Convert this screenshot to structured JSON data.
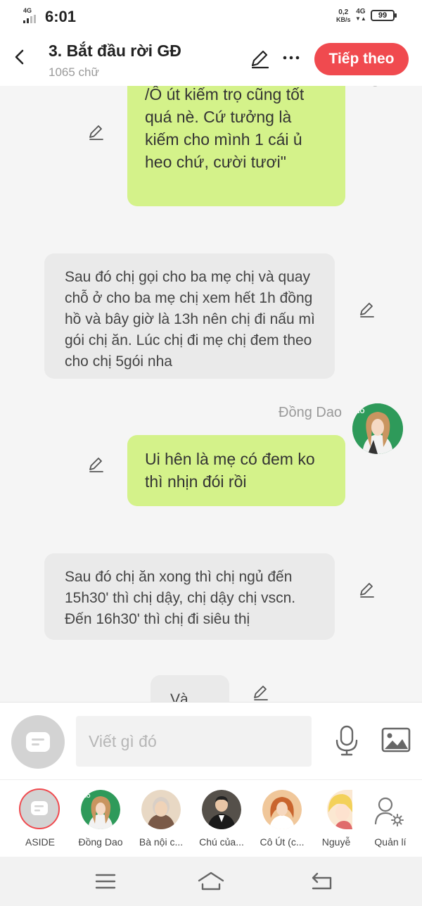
{
  "status_bar": {
    "network_top": "4G",
    "time": "6:01",
    "speed_value": "0,2",
    "speed_unit": "KB/s",
    "network_right": "4G",
    "battery": "99"
  },
  "header": {
    "title": "3. Bắt đầu rời GĐ",
    "word_count": "1065 chữ",
    "next_label": "Tiếp theo"
  },
  "messages": [
    {
      "side": "right",
      "style": "green",
      "text": "/Ô út kiếm trọ cũng tốt quá nè. Cứ tưởng là kiếm cho mình 1 cái ủ heo chứ, cười tươi\""
    },
    {
      "side": "left",
      "style": "gray",
      "text": "Sau đó chị gọi cho ba mẹ chị và quay chỗ ở cho ba mẹ chị xem hết 1h đồng hồ và bây giờ là 13h nên chị đi nấu mì gói chị ăn. Lúc chị đi mẹ chị đem theo cho chị 5gói nha"
    },
    {
      "side": "right",
      "style": "green",
      "sender": "Đồng Dao",
      "text": "Ui hên là mẹ có đem ko thì nhịn đói rồi"
    },
    {
      "side": "left",
      "style": "gray",
      "text": "Sau đó chị ăn xong thì chị ngủ đến 15h30' thì chị dậy, chị dậy chị vscn. Đến 16h30' thì chị đi siêu thị"
    },
    {
      "side": "left",
      "style": "gray",
      "text": "Và"
    }
  ],
  "composer": {
    "placeholder": "Viết gì đó"
  },
  "characters": [
    {
      "name": "ASIDE"
    },
    {
      "name": "Đồng Dao"
    },
    {
      "name": "Bà nội c..."
    },
    {
      "name": "Chú của..."
    },
    {
      "name": "Cô Út (c..."
    },
    {
      "name": "Nguyễ"
    },
    {
      "name": "Quản lí"
    }
  ],
  "colors": {
    "accent": "#f04a4f",
    "bubble_green": "#d4f28a",
    "bubble_gray": "#eaeaea",
    "background": "#f5f5f5"
  },
  "icons": [
    "back-icon",
    "pencil-icon",
    "more-icon",
    "microphone-icon",
    "image-icon",
    "user-settings-icon",
    "menu-icon",
    "home-icon",
    "return-icon"
  ]
}
